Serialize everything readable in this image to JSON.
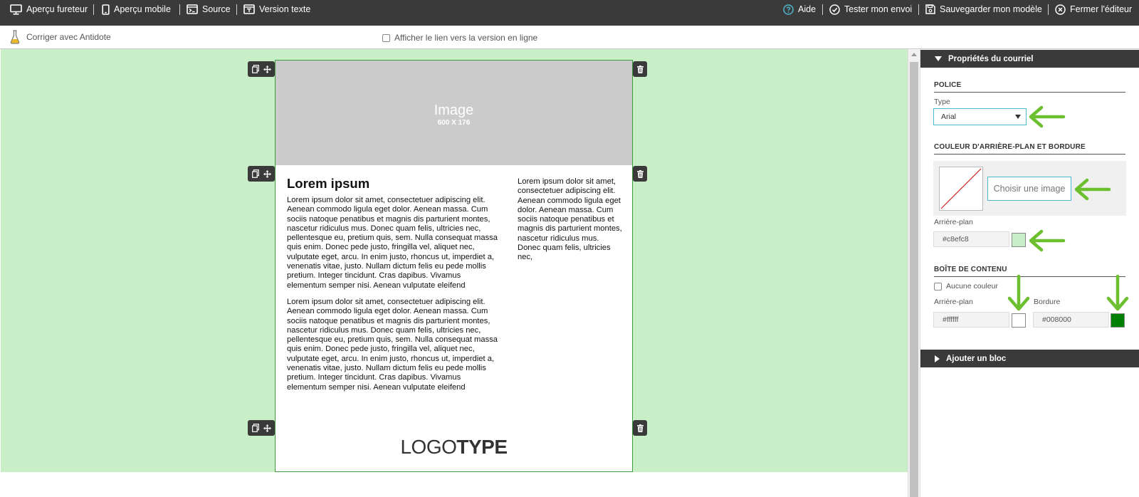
{
  "toolbar": {
    "browser_preview": "Aperçu fureteur",
    "mobile_preview": "Aperçu mobile",
    "source": "Source",
    "text_version": "Version texte",
    "help": "Aide",
    "test_send": "Tester mon envoi",
    "save_template": "Sauvegarder mon modèle",
    "close_editor": "Fermer l'éditeur"
  },
  "secondary": {
    "antidote": "Corriger avec Antidote",
    "show_online_link": "Afficher le lien vers la version en ligne"
  },
  "email": {
    "image_label": "Image",
    "image_size": "600 X 176",
    "heading": "Lorem ipsum",
    "paragraph1": "Lorem ipsum dolor sit amet, consectetuer adipiscing elit. Aenean commodo ligula eget dolor. Aenean massa. Cum sociis natoque penatibus et magnis dis parturient montes, nascetur ridiculus mus. Donec quam felis, ultricies nec, pellentesque eu, pretium quis, sem. Nulla consequat massa quis enim. Donec pede justo, fringilla vel, aliquet nec, vulputate eget, arcu. In enim justo, rhoncus ut, imperdiet a, venenatis vitae, justo. Nullam dictum felis eu pede mollis pretium. Integer tincidunt. Cras dapibus. Vivamus elementum semper nisi. Aenean vulputate eleifend",
    "paragraph2": "Lorem ipsum dolor sit amet, consectetuer adipiscing elit. Aenean commodo ligula eget dolor. Aenean massa. Cum sociis natoque penatibus et magnis dis parturient montes, nascetur ridiculus mus. Donec quam felis, ultricies nec, pellentesque eu, pretium quis, sem. Nulla consequat massa quis enim. Donec pede justo, fringilla vel, aliquet nec, vulputate eget, arcu. In enim justo, rhoncus ut, imperdiet a, venenatis vitae, justo. Nullam dictum felis eu pede mollis pretium. Integer tincidunt. Cras dapibus. Vivamus elementum semper nisi. Aenean vulputate eleifend",
    "side_text": "Lorem ipsum dolor sit amet, consectetuer adipiscing elit. Aenean commodo ligula eget dolor. Aenean massa. Cum sociis natoque penatibus et magnis dis parturient montes, nascetur ridiculus mus. Donec quam felis, ultricies nec,",
    "logo_light": "LOGO",
    "logo_bold": "TYPE"
  },
  "panel": {
    "properties_title": "Propriétés du courriel",
    "font_section": "POLICE",
    "type_label": "Type",
    "font_value": "Arial",
    "bg_section": "COULEUR D'ARRIÈRE-PLAN ET BORDURE",
    "choose_image": "Choisir une image",
    "bg_label": "Arrière-plan",
    "bg_value": "#c8efc8",
    "content_section": "BOÎTE DE CONTENU",
    "no_color": "Aucune couleur",
    "content_bg_label": "Arrière-plan",
    "content_bg_value": "#ffffff",
    "border_label": "Bordure",
    "border_value": "#008000",
    "add_block": "Ajouter un bloc"
  },
  "colors": {
    "background": "#c8efc8",
    "content_background": "#ffffff",
    "border": "#008000",
    "toolbar": "#3a3a3a",
    "accent": "#4fb7d0",
    "arrow_annotation": "#6cc030"
  }
}
